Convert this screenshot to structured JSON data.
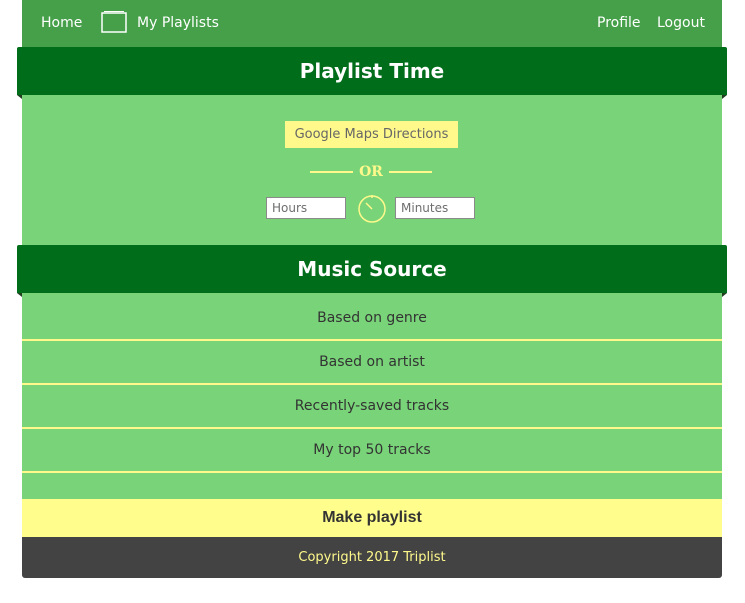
{
  "nav": {
    "home": "Home",
    "my_playlists": "My Playlists",
    "profile": "Profile",
    "logout": "Logout"
  },
  "playlist_time": {
    "title": "Playlist Time",
    "maps_button": "Google Maps Directions",
    "or_text": "OR",
    "hours_placeholder": "Hours",
    "minutes_placeholder": "Minutes",
    "timer_icon": "timer-icon"
  },
  "music_source": {
    "title": "Music Source",
    "options": [
      "Based on genre",
      "Based on artist",
      "Recently-saved tracks",
      "My top 50 tracks"
    ]
  },
  "make_playlist_button": "Make playlist",
  "footer": {
    "copyright": "Copyright 2017 Triplist"
  },
  "colors": {
    "nav_green": "#45a049",
    "header_green": "#006d1b",
    "panel_green": "#79d479",
    "accent_yellow": "#fff98c",
    "footer_gray": "#434343"
  }
}
